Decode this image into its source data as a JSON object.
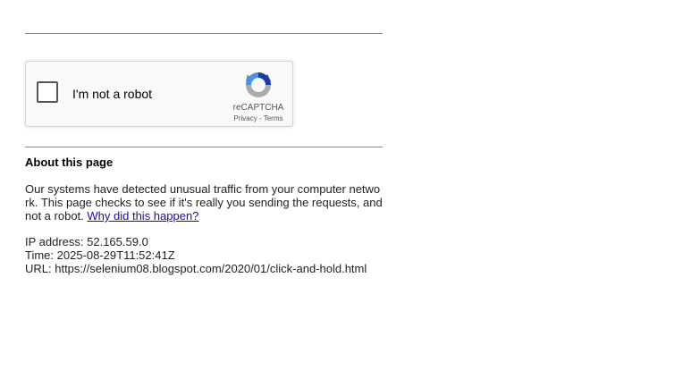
{
  "captcha": {
    "label": "I'm not a robot",
    "brand": "reCAPTCHA",
    "privacy_link": "Privacy",
    "separator": " - ",
    "terms_link": "Terms",
    "logo_icon": "recaptcha-logo-icon",
    "colors": {
      "blue": "#4a90e2",
      "dark_blue": "#1c3aa9",
      "gray": "#ababab"
    }
  },
  "about": {
    "heading": "About this page",
    "line1": "Our systems have detected unusual traffic from your computer netwo",
    "line2": "rk. This page checks to see if it's really you sending the requests, and",
    "line3_text": "not a robot. ",
    "why_link": "Why did this happen?"
  },
  "info": {
    "ip": "IP address: 52.165.59.0",
    "time": "Time: 2025-08-29T11:52:41Z",
    "url": "URL: https://selenium08.blogspot.com/2020/01/click-and-hold.html"
  },
  "colors": {
    "link": "#1a0dab",
    "rule": "#8a8a8a"
  }
}
